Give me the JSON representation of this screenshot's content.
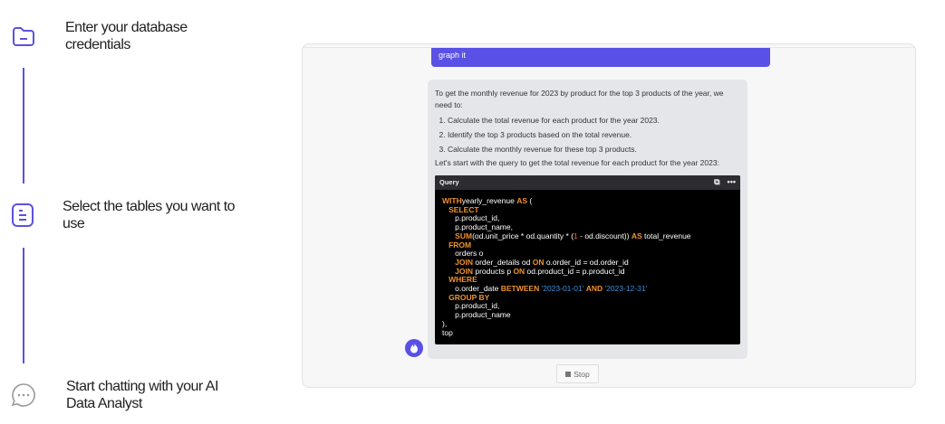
{
  "steps": [
    {
      "label": "Enter your database credentials",
      "icon": "folder-icon"
    },
    {
      "label": "Select the tables you want to use",
      "icon": "document-icon"
    },
    {
      "label": "Start chatting with your AI Data Analyst",
      "icon": "chat-icon"
    }
  ],
  "chat": {
    "user_message": "graph it",
    "assistant": {
      "intro": "To get the monthly revenue for 2023 by product for the top 3 products of the year, we need to:",
      "steps": [
        "Calculate the total revenue for each product for the year 2023.",
        "Identify the top 3 products based on the total revenue.",
        "Calculate the monthly revenue for these top 3 products."
      ],
      "outro": "Let's start with the query to get the total revenue for each product for the year 2023:",
      "code_title": "Query",
      "code_lines": [
        [
          [
            "k",
            "WITH"
          ],
          [
            "",
            "yearly_revenue "
          ],
          [
            "k",
            "AS"
          ],
          [
            "",
            " ("
          ]
        ],
        [
          [
            "",
            "   "
          ],
          [
            "k",
            "SELECT"
          ]
        ],
        [
          [
            "",
            "      p.product_id,"
          ]
        ],
        [
          [
            "",
            "      p.product_name,"
          ]
        ],
        [
          [
            "",
            "      "
          ],
          [
            "k",
            "SUM"
          ],
          [
            "",
            "(od.unit_price * od.quantity * ("
          ],
          [
            "n",
            "1"
          ],
          [
            "",
            " - od.discount)) "
          ],
          [
            "k",
            "AS"
          ],
          [
            "",
            " total_revenue"
          ]
        ],
        [
          [
            "",
            "   "
          ],
          [
            "k",
            "FROM"
          ]
        ],
        [
          [
            "",
            "      orders o"
          ]
        ],
        [
          [
            "",
            "      "
          ],
          [
            "k",
            "JOIN"
          ],
          [
            "",
            " order_details od "
          ],
          [
            "k",
            "ON"
          ],
          [
            "",
            " o.order_id = od.order_id"
          ]
        ],
        [
          [
            "",
            "      "
          ],
          [
            "k",
            "JOIN"
          ],
          [
            "",
            " products p "
          ],
          [
            "k",
            "ON"
          ],
          [
            "",
            " od.product_id = p.product_id"
          ]
        ],
        [
          [
            "",
            "   "
          ],
          [
            "k",
            "WHERE"
          ]
        ],
        [
          [
            "",
            "      o.order_date "
          ],
          [
            "k",
            "BETWEEN"
          ],
          [
            "s",
            " '2023-01-01' "
          ],
          [
            "k",
            "AND"
          ],
          [
            "s",
            " '2023-12-31'"
          ]
        ],
        [
          [
            "",
            "   "
          ],
          [
            "k",
            "GROUP BY"
          ]
        ],
        [
          [
            "",
            "      p.product_id,"
          ]
        ],
        [
          [
            "",
            "      p.product_name"
          ]
        ],
        [
          [
            "",
            "),"
          ]
        ],
        [
          [
            "",
            "top"
          ]
        ]
      ]
    },
    "stop_label": "Stop"
  },
  "colors": {
    "accent": "#5951e5",
    "keyword": "#f0922b",
    "string": "#3f8fd6"
  }
}
